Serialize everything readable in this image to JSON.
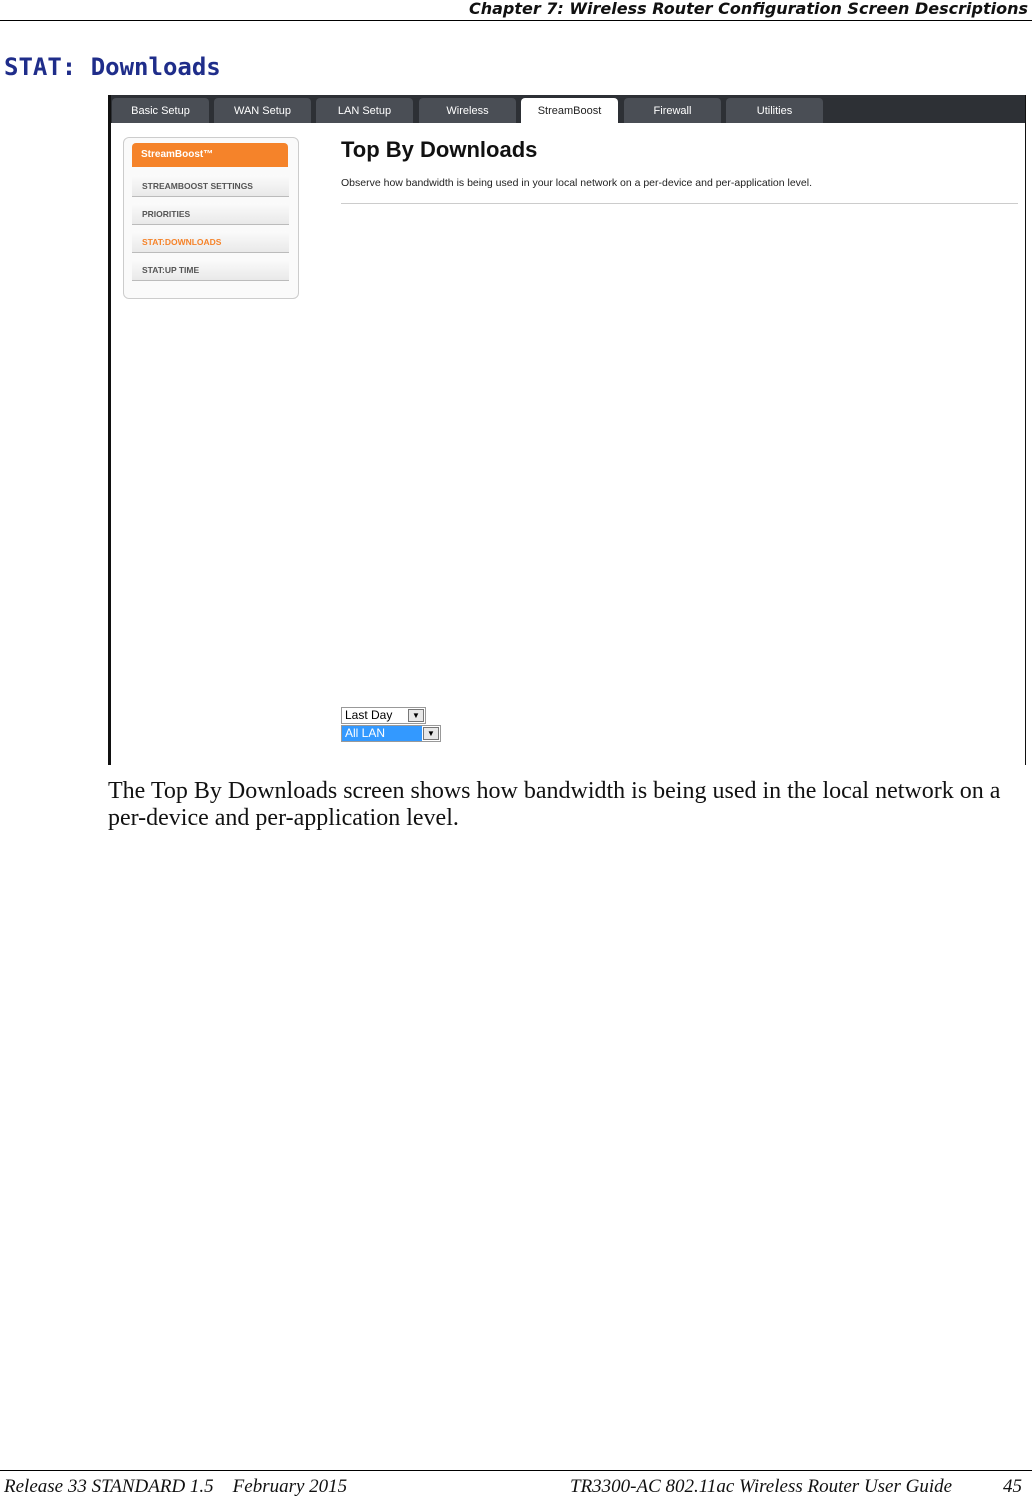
{
  "header": {
    "chapter": "Chapter 7: Wireless Router Configuration Screen Descriptions"
  },
  "section_title": "STAT: Downloads",
  "screenshot": {
    "tabs": [
      {
        "label": "Basic Setup"
      },
      {
        "label": "WAN Setup"
      },
      {
        "label": "LAN Setup"
      },
      {
        "label": "Wireless"
      },
      {
        "label": "StreamBoost",
        "active": true
      },
      {
        "label": "Firewall"
      },
      {
        "label": "Utilities"
      }
    ],
    "sidebar": {
      "heading": "StreamBoost™",
      "items": [
        {
          "label": "STREAMBOOST SETTINGS"
        },
        {
          "label": "PRIORITIES"
        },
        {
          "label": "STAT:DOWNLOADS",
          "active": true
        },
        {
          "label": "STAT:UP TIME"
        }
      ]
    },
    "content": {
      "title": "Top By Downloads",
      "description": "Observe how bandwidth is being used in your local network on a per-device and per-application level.",
      "period_select": "Last Day",
      "hosts_select": "All LAN Hosts"
    },
    "colors": {
      "accent": "#f5832a",
      "tabbar": "#2d3035",
      "selection": "#3399ff"
    }
  },
  "body_text": "The Top By Downloads screen shows how bandwidth is being used in the local network on a per-device and per-application level.",
  "footer": {
    "left": "Release 33 STANDARD 1.5    February 2015",
    "right": "TR3300-AC 802.11ac Wireless Router User Guide",
    "page": "45"
  }
}
